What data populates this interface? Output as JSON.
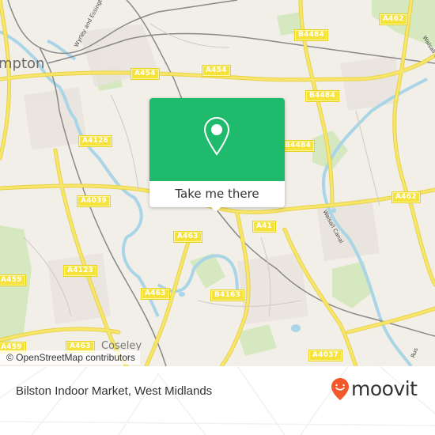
{
  "map": {
    "place_labels": [
      "mpton",
      "Coseley"
    ],
    "road_labels": [
      "A462",
      "B4484",
      "A454",
      "A454",
      "B4484",
      "A4126",
      "B4484",
      "A4039",
      "A462",
      "A463",
      "A41",
      "A4123",
      "A459",
      "A463",
      "B4163",
      "A459",
      "A463",
      "A4037"
    ],
    "waterway_labels": [
      "Wyrley and Essington",
      "Walsall Canal",
      "Walsall Canal",
      "Rus"
    ],
    "attribution": "© OpenStreetMap contributors",
    "colors": {
      "land": "#f2efe9",
      "road": "#f6e24d",
      "water": "#aad3df",
      "park": "#cde6b8",
      "rail": "#7a7a7a"
    }
  },
  "popup": {
    "icon": "map-pin-icon",
    "cta_label": "Take me there",
    "accent_color": "#1fba6b"
  },
  "footer": {
    "location_title": "Bilston Indoor Market, West Midlands",
    "brand_name": "moovit",
    "brand_icon": "moovit-smile-pin-icon",
    "brand_color": "#f2582b"
  }
}
